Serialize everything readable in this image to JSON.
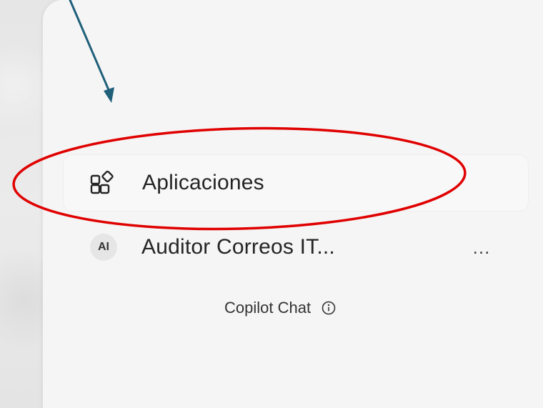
{
  "sidebar": {
    "items": [
      {
        "label": "Aplicaciones",
        "icon": "apps-icon"
      },
      {
        "label": "Auditor Correos IT...",
        "icon": "avatar",
        "avatar_text": "AI",
        "more_label": "..."
      }
    ]
  },
  "footer": {
    "label": "Copilot Chat",
    "icon": "info-icon"
  },
  "annotation": {
    "arrow_color": "#1f5f7a",
    "highlight_color": "#e00000"
  },
  "colors": {
    "panel_background": "#f5f5f5",
    "text": "#242424"
  }
}
